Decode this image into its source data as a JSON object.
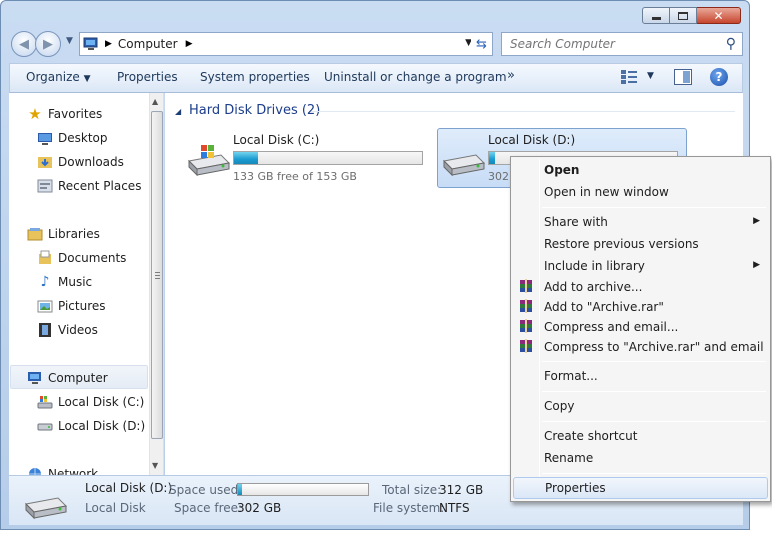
{
  "address": {
    "crumb": "Computer"
  },
  "search": {
    "placeholder": "Search Computer"
  },
  "toolbar": {
    "organize": "Organize",
    "properties": "Properties",
    "system_properties": "System properties",
    "uninstall": "Uninstall or change a program",
    "more": "»"
  },
  "nav": {
    "favorites": "Favorites",
    "desktop": "Desktop",
    "downloads": "Downloads",
    "recent": "Recent Places",
    "libraries": "Libraries",
    "documents": "Documents",
    "music": "Music",
    "pictures": "Pictures",
    "videos": "Videos",
    "computer": "Computer",
    "disk_c": "Local Disk (C:)",
    "disk_d": "Local Disk (D:)",
    "network": "Network"
  },
  "content": {
    "group_title": "Hard Disk Drives (2)",
    "drives": [
      {
        "name": "Local Disk (C:)",
        "free_text": "133 GB free of 153 GB",
        "used_fraction": 0.13
      },
      {
        "name": "Local Disk (D:)",
        "free_text": "302",
        "used_fraction": 0.03
      }
    ]
  },
  "details": {
    "name": "Local Disk (D:)",
    "type": "Local Disk",
    "space_used_label": "Space used:",
    "space_free_label": "Space free:",
    "space_free": "302 GB",
    "total_size_label": "Total size:",
    "total_size": "312 GB",
    "fs_label": "File system:",
    "fs": "NTFS",
    "used_fraction": 0.03
  },
  "context_menu": {
    "open": "Open",
    "open_new": "Open in new window",
    "share": "Share with",
    "restore": "Restore previous versions",
    "include": "Include in library",
    "add_archive": "Add to archive...",
    "add_rar": "Add to \"Archive.rar\"",
    "compress_email": "Compress and email...",
    "compress_rar_email": "Compress to \"Archive.rar\" and email",
    "format": "Format...",
    "copy": "Copy",
    "create_shortcut": "Create shortcut",
    "rename": "Rename",
    "properties": "Properties"
  },
  "icons": {
    "back": "back-arrow-icon",
    "forward": "forward-arrow-icon",
    "refresh": "refresh-icon",
    "search": "search-icon",
    "help": "help-icon",
    "winrar": "winrar-icon"
  },
  "colors": {
    "accent": "#1c3d8a",
    "bar_fill": "#1b9bd0",
    "selection": "#c7dcf6"
  }
}
